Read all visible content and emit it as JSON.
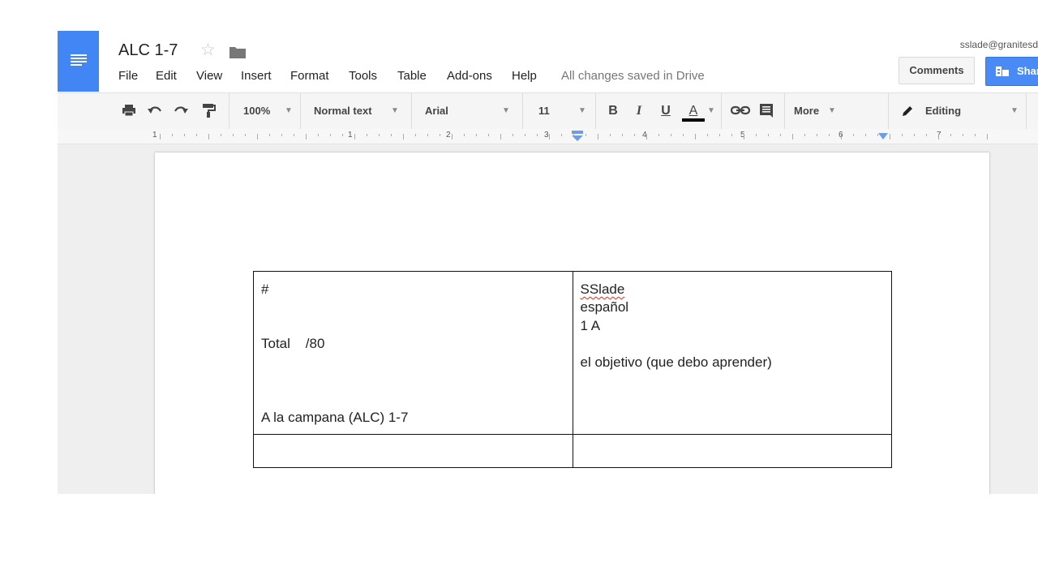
{
  "document": {
    "title": "ALC 1-7",
    "save_status": "All changes saved in Drive"
  },
  "menu": [
    "File",
    "Edit",
    "View",
    "Insert",
    "Format",
    "Tools",
    "Table",
    "Add-ons",
    "Help"
  ],
  "account": {
    "email": "sslade@granitesd",
    "comments_label": "Comments",
    "share_label": "Share"
  },
  "toolbar": {
    "zoom": "100%",
    "style": "Normal text",
    "font": "Arial",
    "size": "11",
    "bold": "B",
    "italic": "I",
    "underline": "U",
    "text_color": "A",
    "more": "More",
    "mode": "Editing",
    "icons": [
      "print-icon",
      "undo-icon",
      "redo-icon",
      "paint-format-icon",
      "link-icon",
      "comment-icon",
      "pencil-icon"
    ]
  },
  "ruler": [
    "1",
    "1",
    "2",
    "3",
    "4",
    "5",
    "6",
    "7"
  ],
  "table": {
    "left_cell": {
      "line1": "#",
      "line2": "Total    /80",
      "line3": "A la campana (ALC) 1-7"
    },
    "right_cell": {
      "line1": "SSlade",
      "line2": "español",
      "line3": "1 A",
      "line4": "el objetivo (que debo aprender)"
    },
    "row2_left": "",
    "row2_right": ""
  },
  "colors": {
    "brand_blue": "#4285f4",
    "share_blue": "#4a8af4",
    "spellcheck_red": "#d93025"
  }
}
